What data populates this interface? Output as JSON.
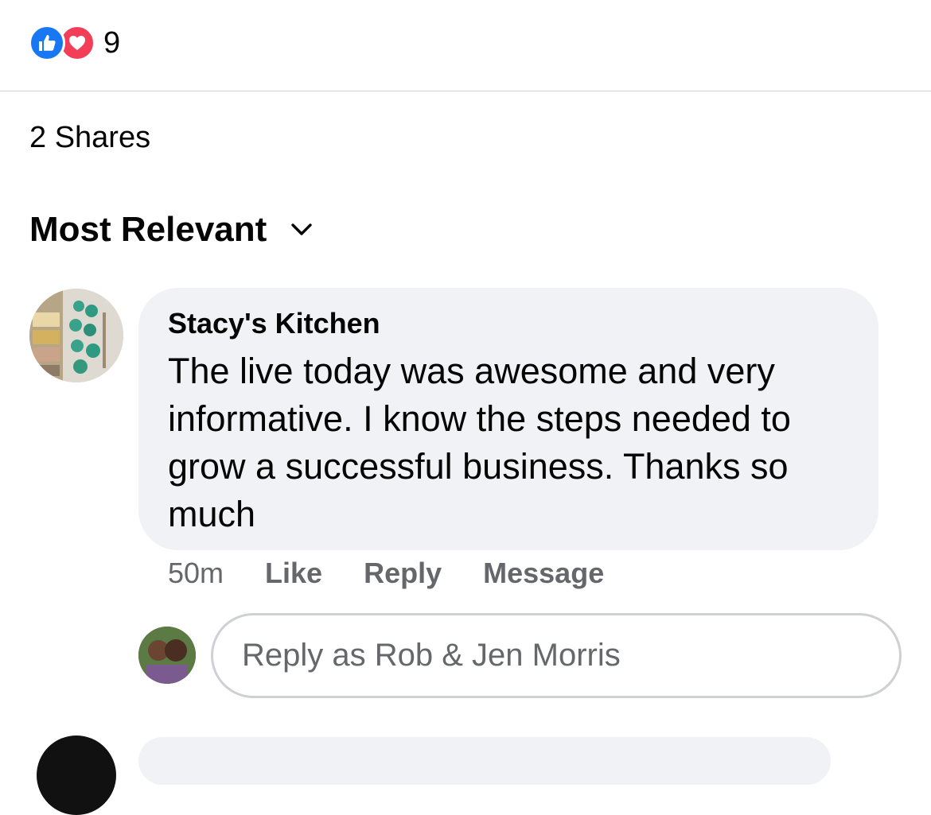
{
  "reactions": {
    "icons": [
      "like-icon",
      "love-icon"
    ],
    "count": "9",
    "colors": {
      "like": "#1877f2",
      "love": "#f33e58"
    }
  },
  "shares": {
    "label": "2 Shares"
  },
  "sort": {
    "label": "Most Relevant",
    "icon": "chevron-down-icon"
  },
  "comment": {
    "author": "Stacy's Kitchen",
    "text": "The live today was awesome and very informative. I know the steps needed to grow a successful business. Thanks so much",
    "time": "50m",
    "actions": {
      "like": "Like",
      "reply": "Reply",
      "message": "Message"
    }
  },
  "reply_box": {
    "placeholder": "Reply as Rob & Jen Morris",
    "value": ""
  },
  "colors": {
    "bubble": "#f0f2f5",
    "secondary_text": "#65676b",
    "divider": "#ced0d4"
  }
}
